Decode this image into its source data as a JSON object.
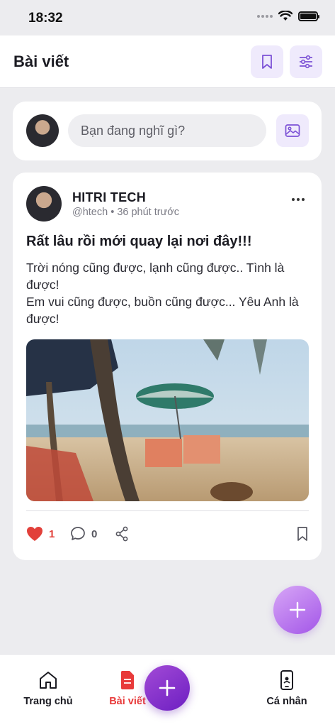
{
  "status_bar": {
    "time": "18:32"
  },
  "header": {
    "title": "Bài viết"
  },
  "composer": {
    "placeholder": "Bạn đang nghĩ gì?"
  },
  "post": {
    "author_name": "HITRI TECH",
    "author_meta": "@htech • 36 phút trước",
    "title": "Rất lâu rồi mới quay lại nơi đây!!!",
    "body_lines": [
      "Trời nóng cũng được, lạnh cũng được.. Tình là được!",
      "Em vui cũng được, buồn cũng được... Yêu Anh là được!"
    ],
    "like_count": "1",
    "comment_count": "0"
  },
  "tabs": {
    "home": "Trang chủ",
    "posts": "Bài viết",
    "profile": "Cá nhân"
  },
  "colors": {
    "accent": "#8a3fd8",
    "active_tab": "#e83a3a",
    "like": "#e2403a",
    "icon_purple": "#7c52d6"
  },
  "icons": {
    "header_bookmark": "bookmark-icon",
    "header_filter": "sliders-icon",
    "composer_image": "image-icon",
    "like": "heart-icon",
    "comment": "comment-icon",
    "share": "share-icon",
    "save": "bookmark-icon",
    "home": "home-icon",
    "posts": "document-icon",
    "profile": "phone-icon",
    "fab": "plus-icon"
  }
}
